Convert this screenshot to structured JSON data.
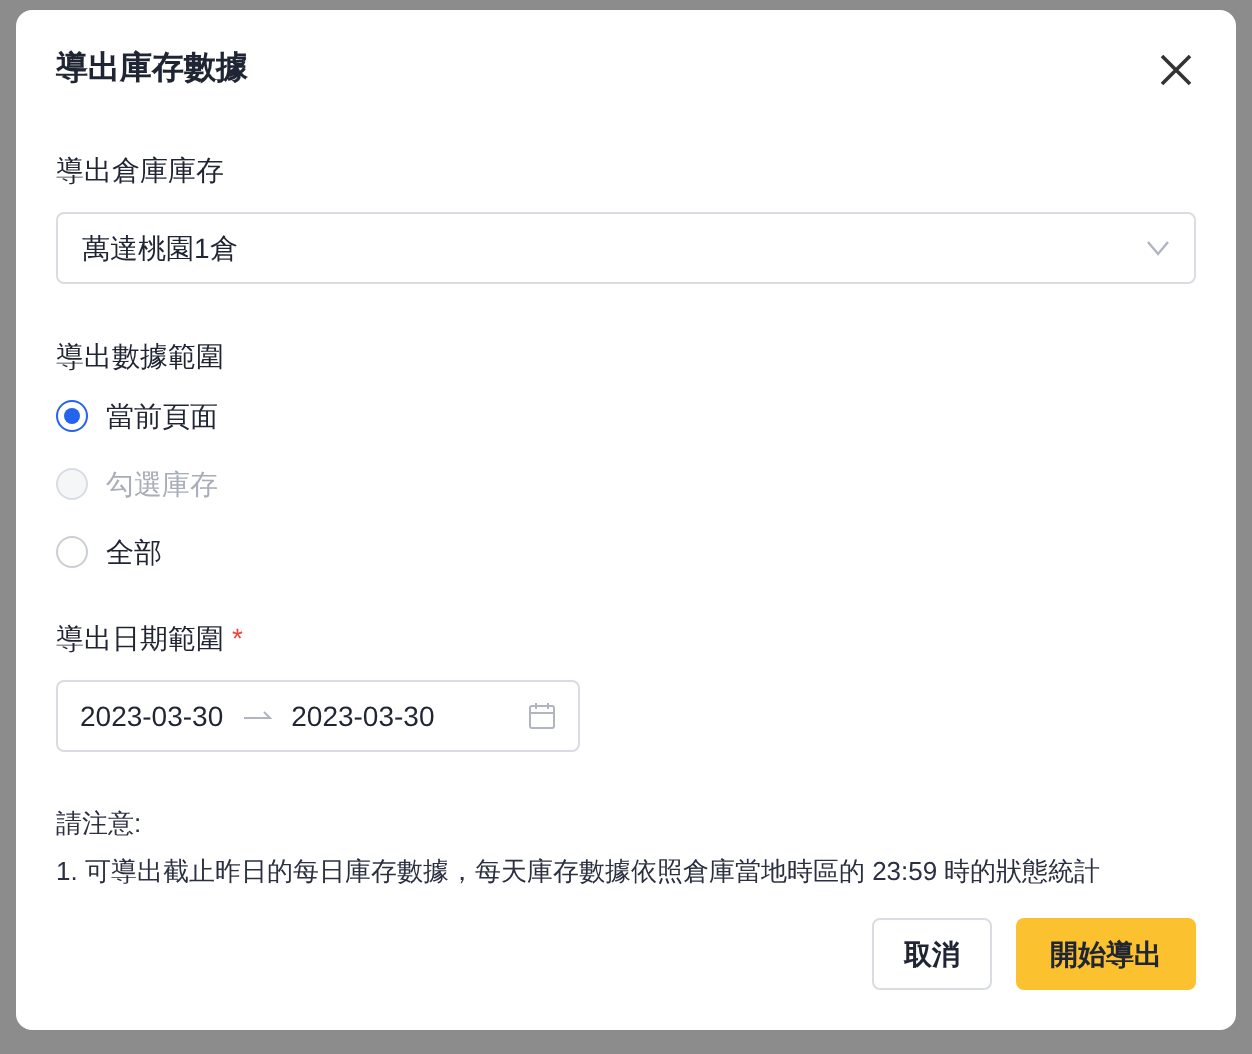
{
  "dialog": {
    "title": "導出庫存數據"
  },
  "warehouse": {
    "label": "導出倉庫庫存",
    "value": "萬達桃園1倉"
  },
  "range": {
    "label": "導出數據範圍",
    "options": [
      {
        "label": "當前頁面",
        "selected": true,
        "disabled": false
      },
      {
        "label": "勾選庫存",
        "selected": false,
        "disabled": true
      },
      {
        "label": "全部",
        "selected": false,
        "disabled": false
      }
    ]
  },
  "dates": {
    "label": "導出日期範圍",
    "required_mark": "*",
    "start": "2023-03-30",
    "end": "2023-03-30"
  },
  "notice": {
    "title": "請注意:",
    "lines": [
      "1. 可導出截止昨日的每日庫存數據，每天庫存數據依照倉庫當地時區的 23:59 時的狀態統計"
    ]
  },
  "buttons": [
    {
      "label": "取消",
      "kind": "secondary"
    },
    {
      "label": "開始導出",
      "kind": "primary"
    }
  ]
}
